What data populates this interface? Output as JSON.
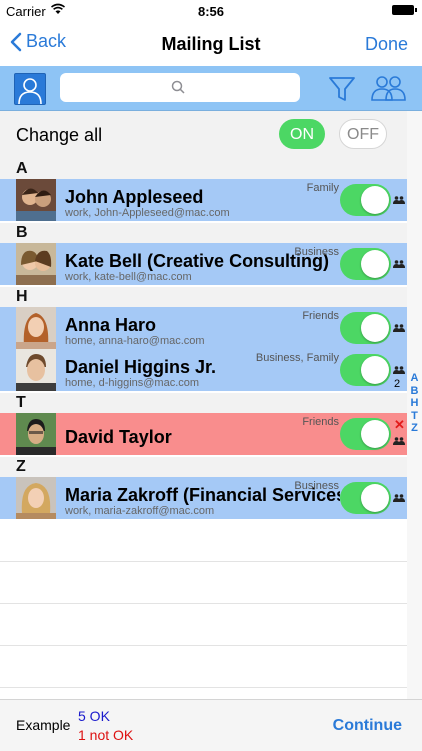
{
  "status_bar": {
    "carrier": "Carrier",
    "time": "8:56"
  },
  "nav": {
    "back_label": "Back",
    "title": "Mailing List",
    "done_label": "Done"
  },
  "toolbar": {
    "search_placeholder": ""
  },
  "change_all": {
    "label": "Change all",
    "on_label": "ON",
    "off_label": "OFF"
  },
  "sections": [
    "A",
    "B",
    "H",
    "T",
    "Z"
  ],
  "contacts": [
    {
      "name": "John Appleseed",
      "email": "work, John-Appleseed@mac.com",
      "group": "Family",
      "enabled": true
    },
    {
      "name": "Kate Bell (Creative Consulting)",
      "email": "work, kate-bell@mac.com",
      "group": "Business",
      "enabled": true
    },
    {
      "name": "Anna Haro",
      "email": "home, anna-haro@mac.com",
      "group": "Friends",
      "enabled": true
    },
    {
      "name": "Daniel Higgins Jr.",
      "email": "home, d-higgins@mac.com",
      "group": "Business, Family",
      "count": "2",
      "enabled": true
    },
    {
      "name": "David Taylor",
      "email": "",
      "group": "Friends",
      "enabled": true,
      "invalid": true
    },
    {
      "name": "Maria Zakroff (Financial Services)",
      "email": "work, maria-zakroff@mac.com",
      "group": "Business",
      "enabled": true
    }
  ],
  "index_letters": [
    "A",
    "B",
    "H",
    "T",
    "Z"
  ],
  "footer": {
    "example_label": "Example",
    "ok_text": "5 OK",
    "not_ok_text": "1 not OK",
    "continue_label": "Continue"
  },
  "colors": {
    "accent": "#2a7ad8",
    "toolbar": "#8ec4f5",
    "row_ok": "#a5c9f6",
    "row_error": "#f98d8d",
    "toggle_on": "#4cd764"
  }
}
